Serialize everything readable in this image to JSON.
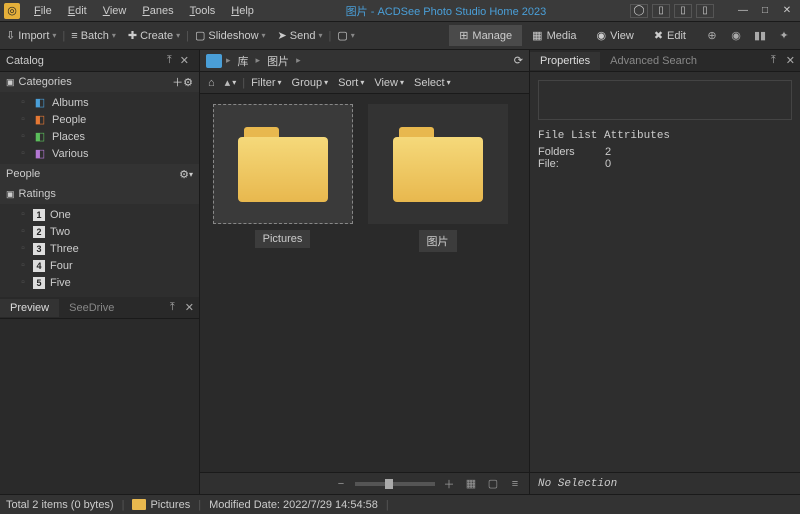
{
  "title": "图片 - ACDSee Photo Studio Home 2023",
  "menu": [
    "File",
    "Edit",
    "View",
    "Panes",
    "Tools",
    "Help"
  ],
  "toolbar": {
    "import": "Import",
    "batch": "Batch",
    "create": "Create",
    "slideshow": "Slideshow",
    "send": "Send"
  },
  "modes": {
    "manage": "Manage",
    "media": "Media",
    "view": "View",
    "edit": "Edit"
  },
  "catalog": {
    "title": "Catalog",
    "categories": "Categories",
    "items": [
      {
        "label": "Albums",
        "color": "#4a9fd8"
      },
      {
        "label": "People",
        "color": "#e57834"
      },
      {
        "label": "Places",
        "color": "#5bbd5b"
      },
      {
        "label": "Various",
        "color": "#b478d4"
      }
    ],
    "people": "People",
    "ratings": "Ratings",
    "rates": [
      "One",
      "Two",
      "Three",
      "Four",
      "Five"
    ]
  },
  "preview": {
    "tab1": "Preview",
    "tab2": "SeeDrive"
  },
  "breadcrumb": [
    "库",
    "图片"
  ],
  "filters": [
    "Filter",
    "Group",
    "Sort",
    "View",
    "Select"
  ],
  "folders": [
    {
      "name": "Pictures",
      "sel": true
    },
    {
      "name": "图片",
      "sel": false
    }
  ],
  "props": {
    "tab1": "Properties",
    "tab2": "Advanced Search",
    "attrs": "File List Attributes",
    "rows": [
      {
        "k": "Folders",
        "v": "2"
      },
      {
        "k": "File:",
        "v": "0"
      }
    ],
    "nosel": "No Selection"
  },
  "status": {
    "items": "Total 2 items  (0 bytes)",
    "folder": "Pictures",
    "date": "Modified Date: 2022/7/29 14:54:58"
  }
}
